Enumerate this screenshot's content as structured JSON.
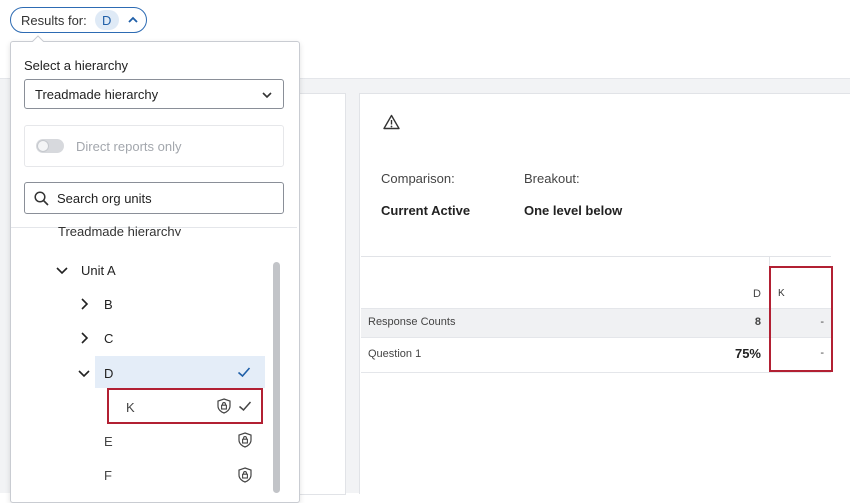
{
  "filter": {
    "label": "Results for:",
    "value": "D"
  },
  "panel": {
    "hierarchy_label": "Select a hierarchy",
    "hierarchy_value": "Treadmade hierarchy",
    "direct_reports_label": "Direct reports only",
    "search_placeholder": "Search org units",
    "tree_cut_text": "Treadmade hierarchy",
    "tree": [
      {
        "label": "Unit A"
      },
      {
        "label": "B"
      },
      {
        "label": "C"
      },
      {
        "label": "D"
      },
      {
        "label": "K"
      },
      {
        "label": "E"
      },
      {
        "label": "F"
      }
    ]
  },
  "report": {
    "comparison_label": "Comparison:",
    "comparison_value": "Current Active",
    "breakout_label": "Breakout:",
    "breakout_value": "One level below",
    "columns": [
      "D",
      "K"
    ],
    "rows": [
      {
        "label": "Response Counts",
        "values": [
          "8",
          "-"
        ]
      },
      {
        "label": "Question 1",
        "values": [
          "75%",
          "-"
        ]
      }
    ]
  },
  "colors": {
    "accent": "#1f5fa8",
    "highlight": "#b22033",
    "selected_bg": "#e4edf8"
  }
}
